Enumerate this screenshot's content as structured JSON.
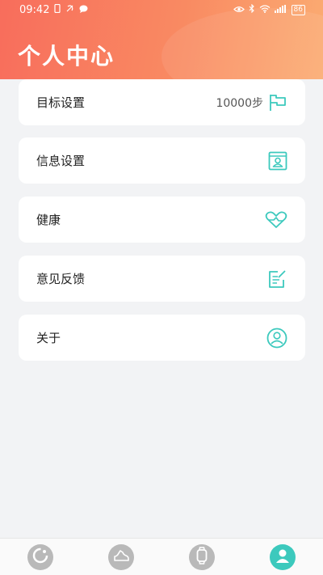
{
  "status_bar": {
    "time": "09:42",
    "battery": "86"
  },
  "header": {
    "title": "个人中心"
  },
  "menu": {
    "items": [
      {
        "label": "目标设置",
        "value": "10000步",
        "icon": "flag-icon"
      },
      {
        "label": "信息设置",
        "icon": "profile-card-icon"
      },
      {
        "label": "健康",
        "icon": "heart-icon"
      },
      {
        "label": "意见反馈",
        "icon": "feedback-edit-icon"
      },
      {
        "label": "关于",
        "icon": "user-circle-icon"
      }
    ]
  },
  "bottom_nav": {
    "items": [
      {
        "icon": "activity-ring-icon",
        "active": false
      },
      {
        "icon": "shoe-icon",
        "active": false
      },
      {
        "icon": "watch-icon",
        "active": false
      },
      {
        "icon": "person-icon",
        "active": true
      }
    ]
  },
  "colors": {
    "accent": "#3cc9bd",
    "header_start": "#f86d5c",
    "header_end": "#fbac72",
    "background": "#f2f3f5"
  }
}
